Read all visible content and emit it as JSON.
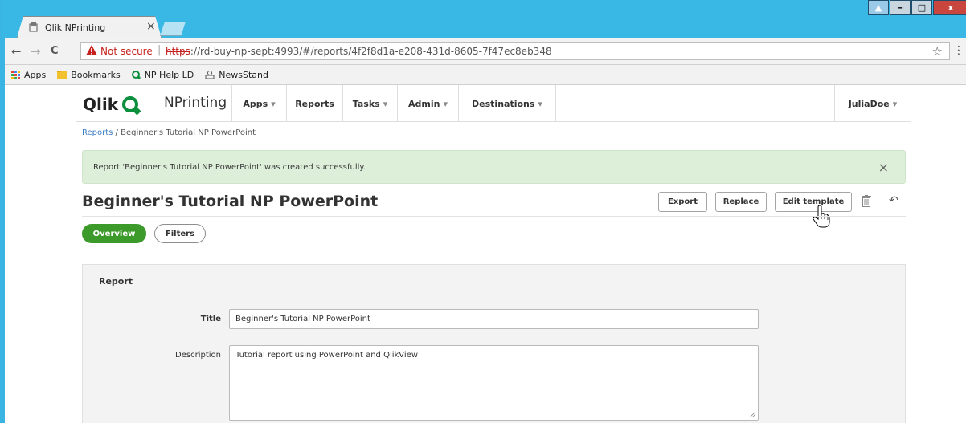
{
  "browser": {
    "tab_title": "Qlik NPrinting",
    "tab_close": "×",
    "window_buttons": [
      "▲",
      "–",
      "□",
      "x"
    ],
    "nav": {
      "back": "←",
      "forward": "→",
      "reload": "C"
    },
    "security_label": "Not secure",
    "url_protocol": "https",
    "url_rest": "://rd-buy-np-sept:4993/#/reports/4f2f8d1a-e208-431d-8605-7f47ec8eb348",
    "bookmarks": [
      "Apps",
      "Bookmarks",
      "NP Help LD",
      "NewsStand"
    ]
  },
  "app": {
    "logo": "Qlik",
    "product": "NPrinting",
    "nav": {
      "apps": "Apps",
      "reports": "Reports",
      "tasks": "Tasks",
      "admin": "Admin",
      "destinations": "Destinations",
      "user": "JuliaDoe"
    },
    "caret": "▾"
  },
  "breadcrumb": {
    "link": "Reports",
    "separator": "/",
    "current": "Beginner's Tutorial NP PowerPoint"
  },
  "alert": {
    "text": "Report 'Beginner's Tutorial NP PowerPoint' was created successfully.",
    "close": "×"
  },
  "page": {
    "title": "Beginner's Tutorial NP PowerPoint",
    "buttons": {
      "export": "Export",
      "replace": "Replace",
      "edit_template": "Edit template"
    },
    "undo_icon": "↶"
  },
  "tabs": {
    "overview": "Overview",
    "filters": "Filters"
  },
  "panel": {
    "title": "Report",
    "title_label": "Title",
    "title_value": "Beginner's Tutorial NP PowerPoint",
    "description_label": "Description",
    "description_value": "Tutorial report using PowerPoint and QlikView"
  },
  "colors": {
    "window_accent": "#39b8e6",
    "qlik_green": "#0c8f3c",
    "active_pill": "#3c9a2b",
    "success_bg": "#ddeed9",
    "not_secure": "#c5221f"
  }
}
